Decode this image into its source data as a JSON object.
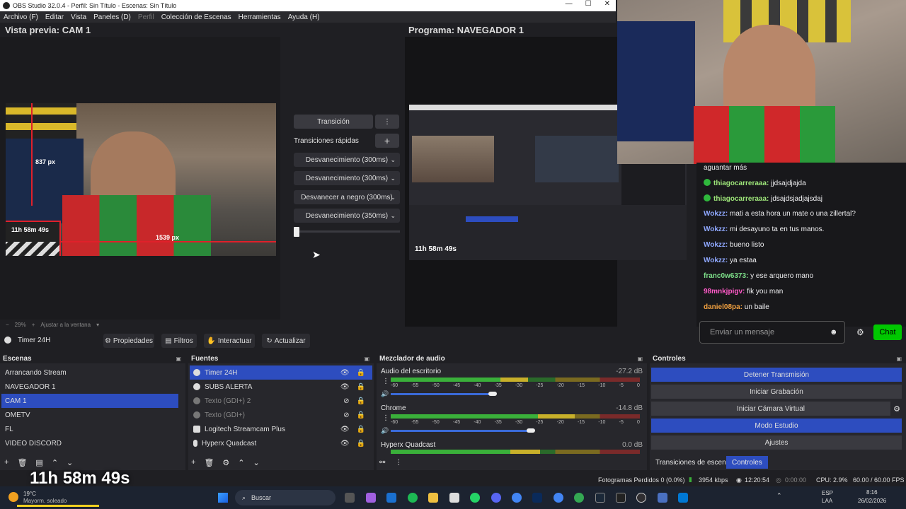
{
  "window": {
    "title": "OBS Studio 32.0.4 - Perfil: Sin Título - Escenas: Sin Título",
    "controls": [
      "—",
      "☐",
      "✕"
    ]
  },
  "menu": [
    "Archivo (F)",
    "Editar",
    "Vista",
    "Paneles (D)",
    "Perfil",
    "Colección de Escenas",
    "Herramientas",
    "Ayuda (H)"
  ],
  "preview": {
    "title": "Vista previa: CAM 1",
    "label_837": "837 px",
    "label_1539": "1539 px",
    "timer": "11h 58m 49s",
    "zoom": "29%",
    "fit": "Ajustar a la ventana"
  },
  "program": {
    "title": "Programa: NAVEGADOR 1",
    "timer": "11h 58m 49s"
  },
  "transitions": {
    "button": "Transición",
    "quick": "Transiciones rápidas",
    "items": [
      "Desvanecimiento (300ms)",
      "Desvanecimiento (300ms)",
      "Desvanecer a negro (300ms)",
      "Desvanecimiento (350ms)"
    ]
  },
  "chat": {
    "messages": [
      {
        "user": "",
        "text": "aguantar más",
        "color": "#efeff1",
        "badge": false
      },
      {
        "user": "thiagocarreraaa:",
        "text": " jjdsajdjajda",
        "color": "#9ee67a",
        "badge": true
      },
      {
        "user": "thiagocarreraaa:",
        "text": " jdsajdsjadjajsdaj",
        "color": "#9ee67a",
        "badge": true
      },
      {
        "user": "Wokzz:",
        "text": " mati a esta hora un mate o una zillertal?",
        "color": "#8fa8ff",
        "badge": false
      },
      {
        "user": "Wokzz:",
        "text": " mi desayuno ta en tus manos.",
        "color": "#8fa8ff",
        "badge": false
      },
      {
        "user": "Wokzz:",
        "text": " bueno listo",
        "color": "#8fa8ff",
        "badge": false
      },
      {
        "user": "Wokzz:",
        "text": " ya estaa",
        "color": "#8fa8ff",
        "badge": false
      },
      {
        "user": "franc0w6373:",
        "text": " y ese arquero mano",
        "color": "#7ee08a",
        "badge": false
      },
      {
        "user": "98mnkjpigv:",
        "text": " fik you man",
        "color": "#ff5ac8",
        "badge": false
      },
      {
        "user": "daniel08pa:",
        "text": " un baile",
        "color": "#f0a040",
        "badge": false
      }
    ],
    "placeholder": "Enviar un mensaje",
    "button": "Chat"
  },
  "source_toolbar": {
    "current": "Timer 24H",
    "properties": "Propiedades",
    "filters": "Filtros",
    "interact": "Interactuar",
    "refresh": "Actualizar"
  },
  "scenes": {
    "title": "Escenas",
    "items": [
      "Arrancando Stream",
      "NAVEGADOR 1",
      "CAM 1",
      "OMETV",
      "FL",
      "VIDEO DISCORD"
    ],
    "selected": 2
  },
  "sources": {
    "title": "Fuentes",
    "items": [
      {
        "name": "Timer 24H",
        "dim": false
      },
      {
        "name": "SUBS ALERTA",
        "dim": false
      },
      {
        "name": "Texto (GDI+) 2",
        "dim": true
      },
      {
        "name": "Texto (GDI+)",
        "dim": true
      },
      {
        "name": "Logitech Streamcam Plus",
        "dim": false
      },
      {
        "name": "Hyperx Quadcast",
        "dim": false
      }
    ]
  },
  "mixer": {
    "title": "Mezclador de audio",
    "scale": [
      "-60",
      "-55",
      "-50",
      "-45",
      "-40",
      "-35",
      "-30",
      "-25",
      "-20",
      "-15",
      "-10",
      "-5",
      "0"
    ],
    "channels": [
      {
        "name": "Audio del escritorio",
        "db": "-27.2 dB",
        "level": 0.55,
        "volume": 0.4
      },
      {
        "name": "Chrome",
        "db": "-14.8 dB",
        "level": 0.74,
        "volume": 0.55
      },
      {
        "name": "Hyperx Quadcast",
        "db": "0.0 dB",
        "level": 0.6,
        "volume": 0.5
      }
    ]
  },
  "controls": {
    "title": "Controles",
    "stop": "Detener Transmisión",
    "record": "Iniciar Grabación",
    "vcam": "Iniciar Cámara Virtual",
    "studio": "Modo Estudio",
    "settings": "Ajustes",
    "tab_transitions": "Transiciones de escena",
    "tab_controls": "Controles"
  },
  "status": {
    "dropped": "Fotogramas Perdidos 0 (0.0%)",
    "bitrate": "3954 kbps",
    "live": "12:20:54",
    "rec": "0:00:00",
    "cpu": "CPU: 2.9%",
    "fps": "60.00 / 60.00 FPS"
  },
  "taskbar": {
    "temp": "19°C",
    "weather": "Mayorm. soleado",
    "search": "Buscar",
    "lang1": "ESP",
    "lang2": "LAA",
    "time": "8:16",
    "date": "26/02/2026"
  }
}
